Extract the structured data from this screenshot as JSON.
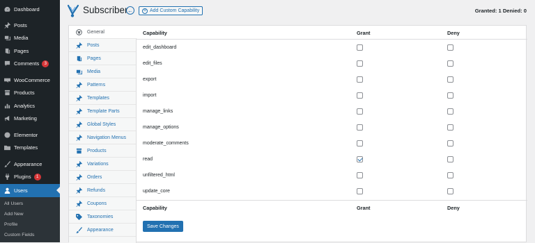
{
  "sidebar": {
    "items": [
      {
        "label": "Dashboard",
        "icon": "dashboard-icon"
      },
      {
        "label": "Posts",
        "icon": "pin-icon"
      },
      {
        "label": "Media",
        "icon": "media-icon"
      },
      {
        "label": "Pages",
        "icon": "pages-icon"
      },
      {
        "label": "Comments",
        "icon": "comment-icon",
        "badge": "3"
      },
      {
        "label": "WooCommerce",
        "icon": "woocommerce-icon"
      },
      {
        "label": "Products",
        "icon": "products-icon"
      },
      {
        "label": "Analytics",
        "icon": "analytics-icon"
      },
      {
        "label": "Marketing",
        "icon": "megaphone-icon"
      },
      {
        "label": "Elementor",
        "icon": "elementor-icon"
      },
      {
        "label": "Templates",
        "icon": "folder-icon"
      },
      {
        "label": "Appearance",
        "icon": "brush-icon"
      },
      {
        "label": "Plugins",
        "icon": "plugin-icon",
        "badge": "1"
      },
      {
        "label": "Users",
        "icon": "user-icon"
      }
    ],
    "submenu": [
      "All Users",
      "Add New",
      "Profile",
      "Custom Fields"
    ]
  },
  "header": {
    "title": "Subscriber",
    "add_label": "Add Custom Capability",
    "summary": "Granted: 1 Denied: 0"
  },
  "tabs": [
    {
      "label": "General",
      "icon": "wordpress-icon"
    },
    {
      "label": "Posts",
      "icon": "pin-icon"
    },
    {
      "label": "Pages",
      "icon": "pages-icon"
    },
    {
      "label": "Media",
      "icon": "media-icon"
    },
    {
      "label": "Patterns",
      "icon": "pin-icon"
    },
    {
      "label": "Templates",
      "icon": "pin-icon"
    },
    {
      "label": "Template Parts",
      "icon": "pin-icon"
    },
    {
      "label": "Global Styles",
      "icon": "pin-icon"
    },
    {
      "label": "Navigation Menus",
      "icon": "pin-icon"
    },
    {
      "label": "Products",
      "icon": "archive-icon"
    },
    {
      "label": "Variations",
      "icon": "pin-icon"
    },
    {
      "label": "Orders",
      "icon": "pin-icon"
    },
    {
      "label": "Refunds",
      "icon": "pin-icon"
    },
    {
      "label": "Coupons",
      "icon": "pin-icon"
    },
    {
      "label": "Taxonomies",
      "icon": "tag-icon"
    },
    {
      "label": "Appearance",
      "icon": "brush-icon"
    }
  ],
  "table": {
    "headers": [
      "Capability",
      "Grant",
      "Deny"
    ],
    "rows": [
      {
        "capability": "edit_dashboard",
        "grant": false,
        "deny": false
      },
      {
        "capability": "edit_files",
        "grant": false,
        "deny": false
      },
      {
        "capability": "export",
        "grant": false,
        "deny": false
      },
      {
        "capability": "import",
        "grant": false,
        "deny": false
      },
      {
        "capability": "manage_links",
        "grant": false,
        "deny": false
      },
      {
        "capability": "manage_options",
        "grant": false,
        "deny": false
      },
      {
        "capability": "moderate_comments",
        "grant": false,
        "deny": false
      },
      {
        "capability": "read",
        "grant": true,
        "deny": false
      },
      {
        "capability": "unfiltered_html",
        "grant": false,
        "deny": false
      },
      {
        "capability": "update_core",
        "grant": false,
        "deny": false
      }
    ]
  },
  "save_label": "Save Changes",
  "colors": {
    "accent": "#2271b1",
    "menu_bg": "#1d2327",
    "badge": "#d63638"
  }
}
